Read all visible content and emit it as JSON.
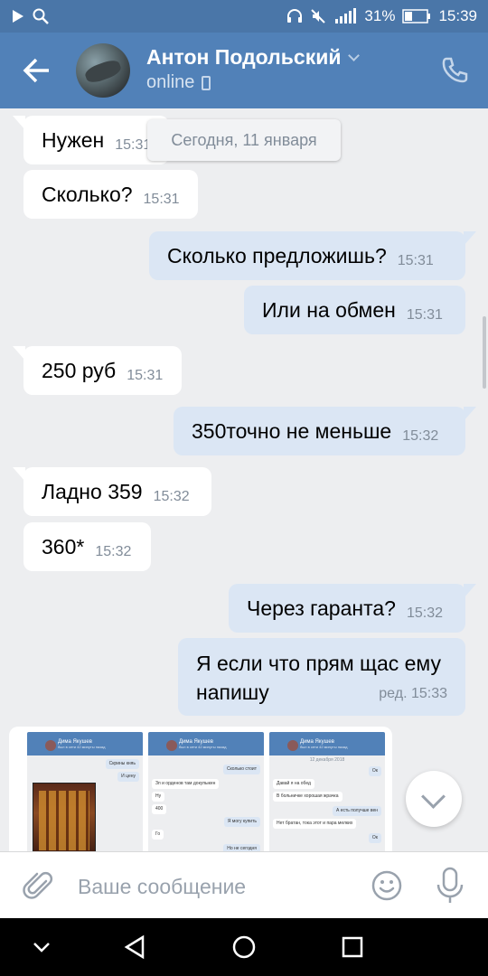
{
  "status_bar": {
    "battery": "31%",
    "time": "15:39"
  },
  "header": {
    "contact_name": "Антон Подольский",
    "contact_status": "online"
  },
  "chat": {
    "date_divider": "Сегодня, 11 января",
    "messages": [
      {
        "text": "Нужен",
        "time": "15:31",
        "direction": "in"
      },
      {
        "text": "Сколько?",
        "time": "15:31",
        "direction": "in"
      },
      {
        "text": "Сколько предложишь?",
        "time": "15:31",
        "direction": "out"
      },
      {
        "text": "Или на обмен",
        "time": "15:31",
        "direction": "out"
      },
      {
        "text": "250 руб",
        "time": "15:31",
        "direction": "in"
      },
      {
        "text": "350точно не меньше",
        "time": "15:32",
        "direction": "out"
      },
      {
        "text": "Ладно 359",
        "time": "15:32",
        "direction": "in"
      },
      {
        "text": "360*",
        "time": "15:32",
        "direction": "in"
      },
      {
        "text": "Через гаранта?",
        "time": "15:32",
        "direction": "out"
      },
      {
        "line1": "Я если что прям щас ему",
        "line2": "напишу",
        "time": "ред. 15:33",
        "direction": "out"
      }
    ],
    "attachment_screens": [
      {
        "name": "Дима Якушев",
        "status": "был в сети 42 минуты назад",
        "lines": [
          "Скрины княь",
          "И цену"
        ]
      },
      {
        "name": "Дима Якушев",
        "status": "был в сети 42 минуты назад",
        "lines": [
          "Сколько стоит",
          "Зп и орденов там докупыкен",
          "Ну",
          "400",
          "Я могу купить",
          "Го",
          "Но не сегодня"
        ]
      },
      {
        "name": "Дима Якушев",
        "status": "был в сети 42 минуты назад",
        "lines": [
          "12 декабря 2018",
          "Ок",
          "Давай я на обед",
          "В больничке хорошая жрачка",
          "А есть получше вен",
          "Нет братан, тока этот и пара мелких",
          "Ок"
        ]
      }
    ]
  },
  "input": {
    "placeholder": "Ваше сообщение"
  },
  "colors": {
    "header": "#5181b8",
    "outgoing": "#dbe6f4",
    "incoming": "#ffffff",
    "background": "#edeef0"
  }
}
